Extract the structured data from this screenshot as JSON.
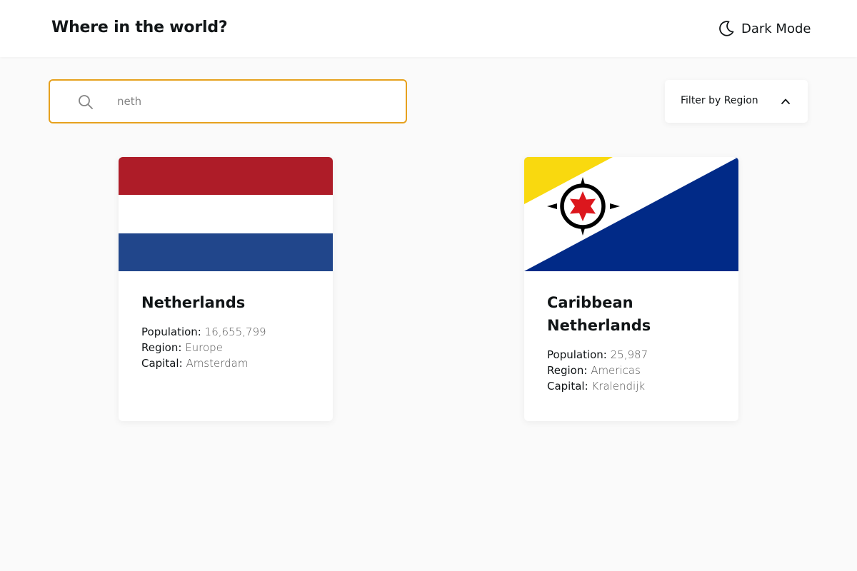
{
  "header": {
    "title": "Where in the world?",
    "dark_mode_label": "Dark Mode",
    "dark_mode_icon": "moon-icon"
  },
  "search": {
    "value": "neth",
    "placeholder": "Search for a country...",
    "icon": "search-icon",
    "border_color": "#e6a11e"
  },
  "filter": {
    "label": "Filter by Region",
    "icon": "chevron-up-icon"
  },
  "countries": [
    {
      "name": "Netherlands",
      "population_label": "Population:",
      "population": "16,655,799",
      "region_label": "Region:",
      "region": "Europe",
      "capital_label": "Capital:",
      "capital": "Amsterdam",
      "flag": "netherlands-flag",
      "flag_colors": [
        "#ae1c28",
        "#ffffff",
        "#21468b"
      ]
    },
    {
      "name": "Caribbean Netherlands",
      "population_label": "Population:",
      "population": "25,987",
      "region_label": "Region:",
      "region": "Americas",
      "capital_label": "Capital:",
      "capital": "Kralendijk",
      "flag": "bonaire-flag",
      "flag_colors": [
        "#f9d90f",
        "#ffffff",
        "#012a87",
        "#dc171d",
        "#000000"
      ]
    }
  ]
}
